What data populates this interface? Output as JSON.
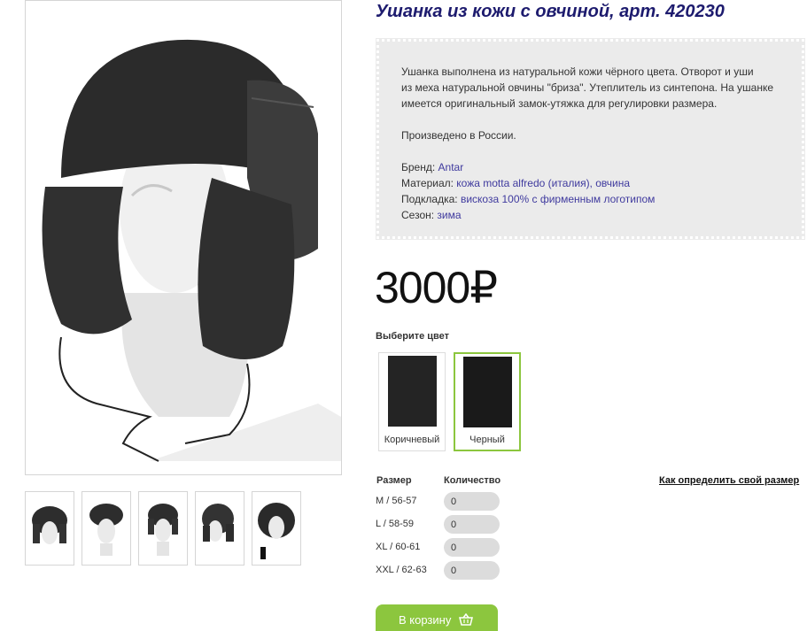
{
  "product": {
    "title": "Ушанка из кожи с овчиной, арт. 420230",
    "description_line1": "Ушанка выполнена из натуральной кожи чёрного цвета. Отворот и уши",
    "description_line2": "из меха натуральной  овчины \"бриза\". Утеплитель из синтепона. На ушанке",
    "description_line3": "имеется оригинальный замок-утяжка для регулировки размера.",
    "made_in": "Произведено в России.",
    "attributes": [
      {
        "label": "Бренд: ",
        "value": "Antar"
      },
      {
        "label": "Материал: ",
        "value": "кожа motta alfredo (италия), овчина"
      },
      {
        "label": "Подкладка: ",
        "value": "вискоза 100% с фирменным логотипом"
      },
      {
        "label": "Сезон: ",
        "value": "зима"
      }
    ],
    "price": "3000₽"
  },
  "colors": {
    "label": "Выберите цвет",
    "options": [
      {
        "name": "Коричневый",
        "swatch": "#242424"
      },
      {
        "name": "Черный",
        "swatch": "#1a1a1a",
        "selected": true
      }
    ]
  },
  "sizes": {
    "size_header": "Размер",
    "quantity_header": "Количество",
    "help_link": "Как определить свой размер",
    "rows": [
      {
        "size": "M / 56-57",
        "qty": "0"
      },
      {
        "size": "L / 58-59",
        "qty": "0"
      },
      {
        "size": "XL / 60-61",
        "qty": "0"
      },
      {
        "size": "XXL / 62-63",
        "qty": "0"
      }
    ]
  },
  "cart": {
    "label": "В корзину"
  },
  "theme": {
    "title_color": "#1d1b6e",
    "link_color": "#3f3a9e",
    "accent_green": "#8cc63e"
  }
}
